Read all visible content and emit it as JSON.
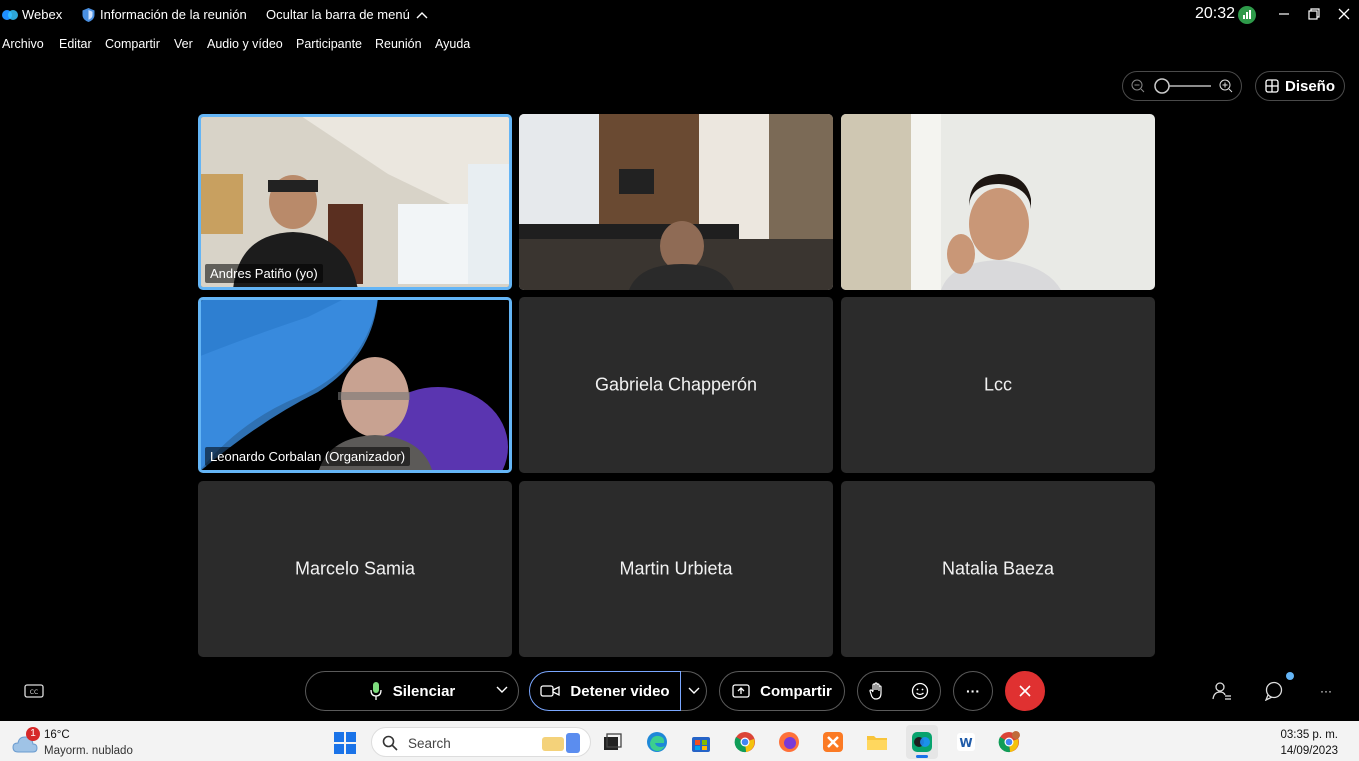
{
  "titlebar": {
    "app_name": "Webex",
    "meeting_info": "Información de la reunión",
    "hide_menu": "Ocultar la barra de menú",
    "time": "20:32"
  },
  "menu": [
    "Archivo",
    "Editar",
    "Compartir",
    "Ver",
    "Audio y vídeo",
    "Participante",
    "Reunión",
    "Ayuda"
  ],
  "layout_button": "Diseño",
  "participants": [
    {
      "name": "Andres Patiño (yo)",
      "video": true
    },
    {
      "name": "",
      "video": true
    },
    {
      "name": "",
      "video": true
    },
    {
      "name": "Leonardo Corbalan (Organizador)",
      "video": true
    },
    {
      "name": "Gabriela Chapperón",
      "video": false
    },
    {
      "name": "Lcc",
      "video": false
    },
    {
      "name": "Marcelo Samia",
      "video": false
    },
    {
      "name": "Martin Urbieta",
      "video": false
    },
    {
      "name": "Natalia Baeza",
      "video": false
    }
  ],
  "controls": {
    "mute": "Silenciar",
    "stop_video": "Detener video",
    "share": "Compartir",
    "more": "···"
  },
  "taskbar": {
    "weather_badge": "1",
    "temperature": "16°C",
    "weather_desc": "Mayorm. nublado",
    "search_placeholder": "Search",
    "time": "03:35 p. m.",
    "date": "14/09/2023"
  },
  "colors": {
    "accent": "#64b5f6",
    "end_call": "#e03131",
    "tile_bg": "#2b2b2b"
  }
}
